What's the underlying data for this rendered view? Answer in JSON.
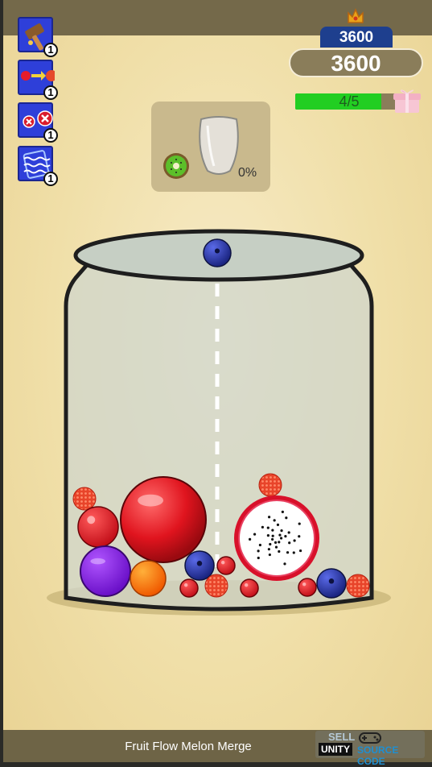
{
  "hud": {
    "best_score": "3600",
    "score": "3600",
    "progress_text": "4/5",
    "progress_fraction": 0.8
  },
  "boosters": [
    {
      "name": "hammer",
      "icon": "hammer-icon",
      "count": "1"
    },
    {
      "name": "upgrade",
      "icon": "fruit-upgrade-icon",
      "count": "1"
    },
    {
      "name": "remove",
      "icon": "remove-fruits-icon",
      "count": "1"
    },
    {
      "name": "shake",
      "icon": "shake-icon",
      "count": "1"
    }
  ],
  "next_panel": {
    "next_fruit": "kiwi",
    "glass_percent": "0%"
  },
  "held_fruit": "blueberry",
  "jar_fruits": [
    {
      "type": "raspberry"
    },
    {
      "type": "cherry"
    },
    {
      "type": "apple"
    },
    {
      "type": "raspberry"
    },
    {
      "type": "dragonfruit"
    },
    {
      "type": "plum"
    },
    {
      "type": "orange"
    },
    {
      "type": "blueberry"
    },
    {
      "type": "redcurrant"
    },
    {
      "type": "redcurrant"
    },
    {
      "type": "raspberry"
    },
    {
      "type": "redcurrant"
    },
    {
      "type": "redcurrant"
    },
    {
      "type": "blueberry"
    },
    {
      "type": "raspberry"
    }
  ],
  "footer": {
    "title": "Fruit Flow Melon Merge",
    "watermark_sell": "SELL",
    "watermark_unity": "UNITY",
    "watermark_source": "SOURCE CODE"
  },
  "colors": {
    "booster_bg": "#2e3fd9",
    "best_score_bg": "#1e3f8e",
    "progress_fill": "#22ce22",
    "background": "#f0dfa8"
  }
}
